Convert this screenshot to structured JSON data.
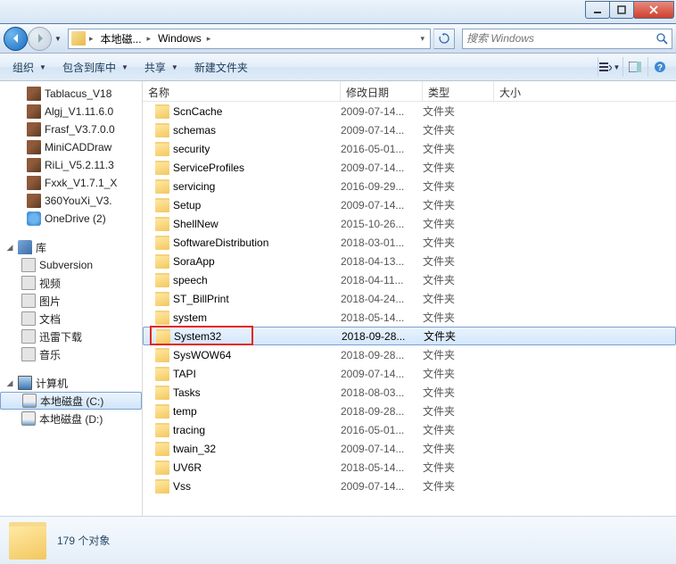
{
  "address": {
    "crumbs": [
      "本地磁...",
      "Windows"
    ]
  },
  "search": {
    "placeholder": "搜索 Windows"
  },
  "toolbar": {
    "organize": "组织",
    "include": "包含到库中",
    "share": "共享",
    "newfolder": "新建文件夹"
  },
  "columns": {
    "name": "名称",
    "date": "修改日期",
    "type": "类型",
    "size": "大小"
  },
  "navpane": {
    "top_items": [
      {
        "label": "Tablacus_V18",
        "icon": "i-zip"
      },
      {
        "label": "Algj_V1.11.6.0",
        "icon": "i-zip"
      },
      {
        "label": "Frasf_V3.7.0.0",
        "icon": "i-zip"
      },
      {
        "label": "MiniCADDraw",
        "icon": "i-zip"
      },
      {
        "label": "RiLi_V5.2.11.3",
        "icon": "i-zip"
      },
      {
        "label": "Fxxk_V1.7.1_X",
        "icon": "i-zip"
      },
      {
        "label": "360YouXi_V3.",
        "icon": "i-zip"
      },
      {
        "label": "OneDrive (2)",
        "icon": "i-cloud"
      }
    ],
    "libraries_label": "库",
    "libraries": [
      {
        "label": "Subversion",
        "icon": "i-generic"
      },
      {
        "label": "视频",
        "icon": "i-generic"
      },
      {
        "label": "图片",
        "icon": "i-generic"
      },
      {
        "label": "文档",
        "icon": "i-generic"
      },
      {
        "label": "迅雷下载",
        "icon": "i-generic"
      },
      {
        "label": "音乐",
        "icon": "i-generic"
      }
    ],
    "computer_label": "计算机",
    "drives": [
      {
        "label": "本地磁盘 (C:)",
        "icon": "i-drive",
        "selected": true
      },
      {
        "label": "本地磁盘 (D:)",
        "icon": "i-drive"
      }
    ]
  },
  "files": [
    {
      "name": "ScnCache",
      "date": "2009-07-14...",
      "type": "文件夹"
    },
    {
      "name": "schemas",
      "date": "2009-07-14...",
      "type": "文件夹"
    },
    {
      "name": "security",
      "date": "2016-05-01...",
      "type": "文件夹"
    },
    {
      "name": "ServiceProfiles",
      "date": "2009-07-14...",
      "type": "文件夹"
    },
    {
      "name": "servicing",
      "date": "2016-09-29...",
      "type": "文件夹"
    },
    {
      "name": "Setup",
      "date": "2009-07-14...",
      "type": "文件夹"
    },
    {
      "name": "ShellNew",
      "date": "2015-10-26...",
      "type": "文件夹"
    },
    {
      "name": "SoftwareDistribution",
      "date": "2018-03-01...",
      "type": "文件夹"
    },
    {
      "name": "SoraApp",
      "date": "2018-04-13...",
      "type": "文件夹"
    },
    {
      "name": "speech",
      "date": "2018-04-11...",
      "type": "文件夹"
    },
    {
      "name": "ST_BillPrint",
      "date": "2018-04-24...",
      "type": "文件夹"
    },
    {
      "name": "system",
      "date": "2018-05-14...",
      "type": "文件夹"
    },
    {
      "name": "System32",
      "date": "2018-09-28...",
      "type": "文件夹",
      "selected": true,
      "highlighted": true
    },
    {
      "name": "SysWOW64",
      "date": "2018-09-28...",
      "type": "文件夹"
    },
    {
      "name": "TAPI",
      "date": "2009-07-14...",
      "type": "文件夹"
    },
    {
      "name": "Tasks",
      "date": "2018-08-03...",
      "type": "文件夹"
    },
    {
      "name": "temp",
      "date": "2018-09-28...",
      "type": "文件夹"
    },
    {
      "name": "tracing",
      "date": "2016-05-01...",
      "type": "文件夹"
    },
    {
      "name": "twain_32",
      "date": "2009-07-14...",
      "type": "文件夹"
    },
    {
      "name": "UV6R",
      "date": "2018-05-14...",
      "type": "文件夹"
    },
    {
      "name": "Vss",
      "date": "2009-07-14...",
      "type": "文件夹"
    }
  ],
  "status": {
    "count_text": "179 个对象"
  }
}
